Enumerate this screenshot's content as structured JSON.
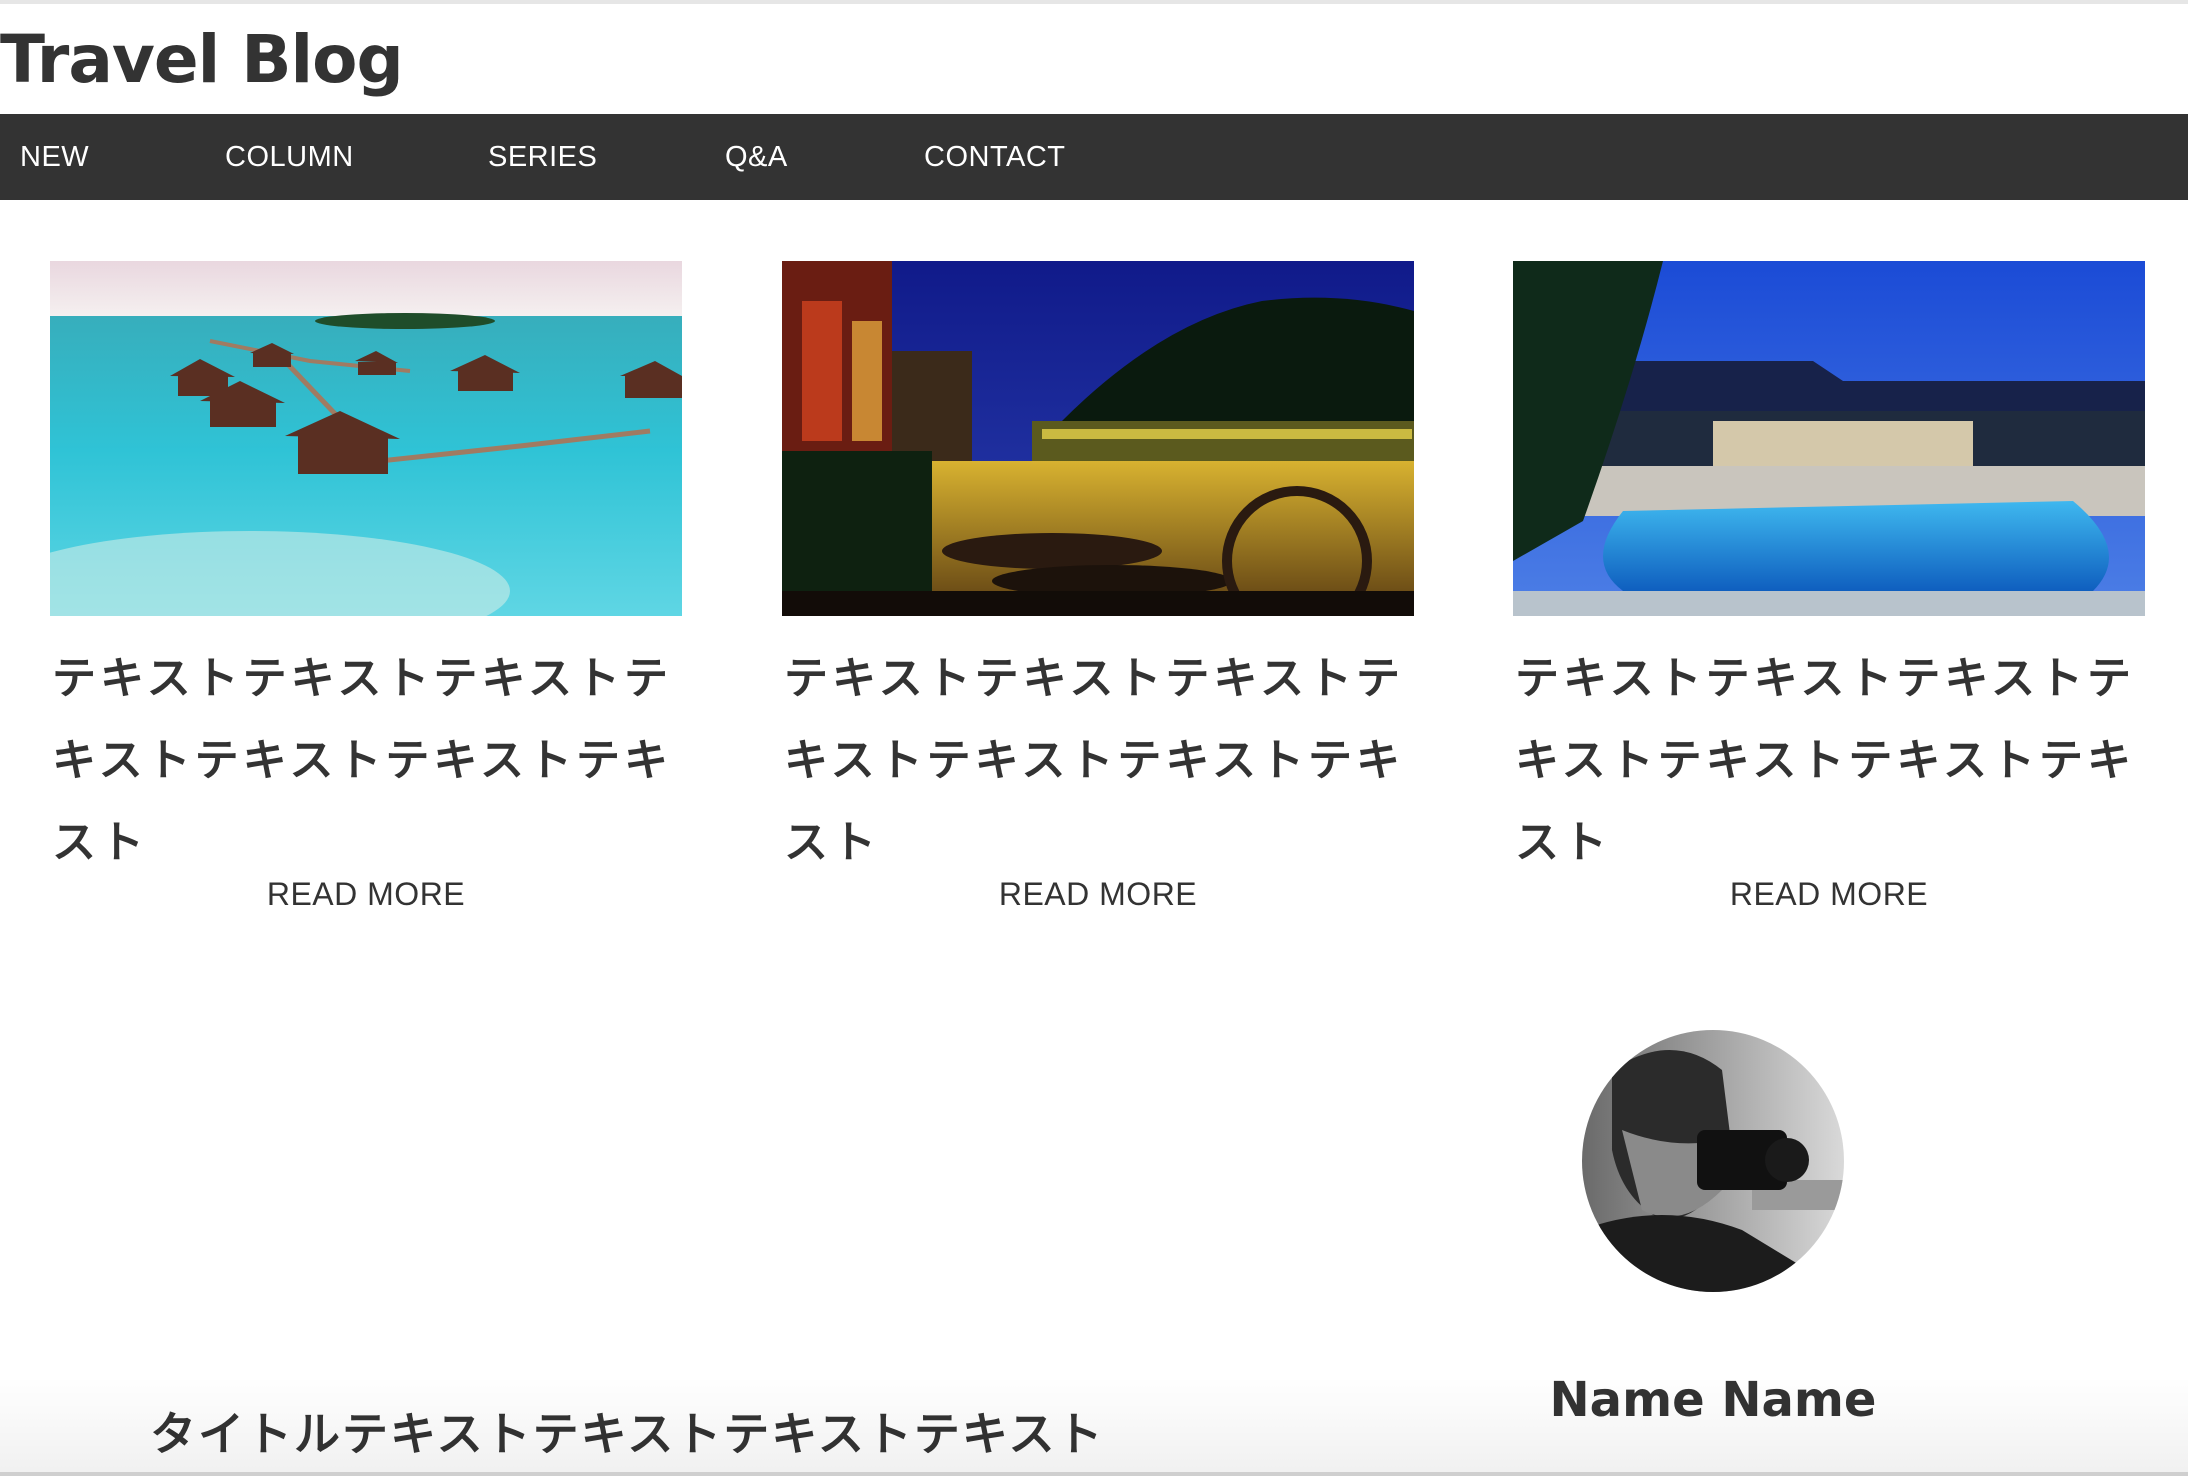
{
  "header": {
    "site_title": "Travel Blog"
  },
  "nav": {
    "items": [
      {
        "label": "NEW"
      },
      {
        "label": "COLUMN"
      },
      {
        "label": "SERIES"
      },
      {
        "label": "Q&A"
      },
      {
        "label": "CONTACT"
      }
    ]
  },
  "cards": [
    {
      "image": "maldives-overwater-villas-photo",
      "title": "テキストテキストテキストテキストテキストテキストテキスト",
      "link": "READ MORE"
    },
    {
      "image": "night-river-town-photo",
      "title": "テキストテキストテキストテキストテキストテキストテキスト",
      "link": "READ MORE"
    },
    {
      "image": "resort-pool-night-photo",
      "title": "テキストテキストテキストテキストテキストテキストテキスト",
      "link": "READ MORE"
    }
  ],
  "profile": {
    "avatar": "photographer-avatar-photo",
    "name": "Name Name"
  },
  "post": {
    "title": "タイトルテキストテキストテキストテキスト"
  },
  "colors": {
    "nav_bg": "#333333",
    "text": "#333333",
    "background": "#ffffff"
  }
}
